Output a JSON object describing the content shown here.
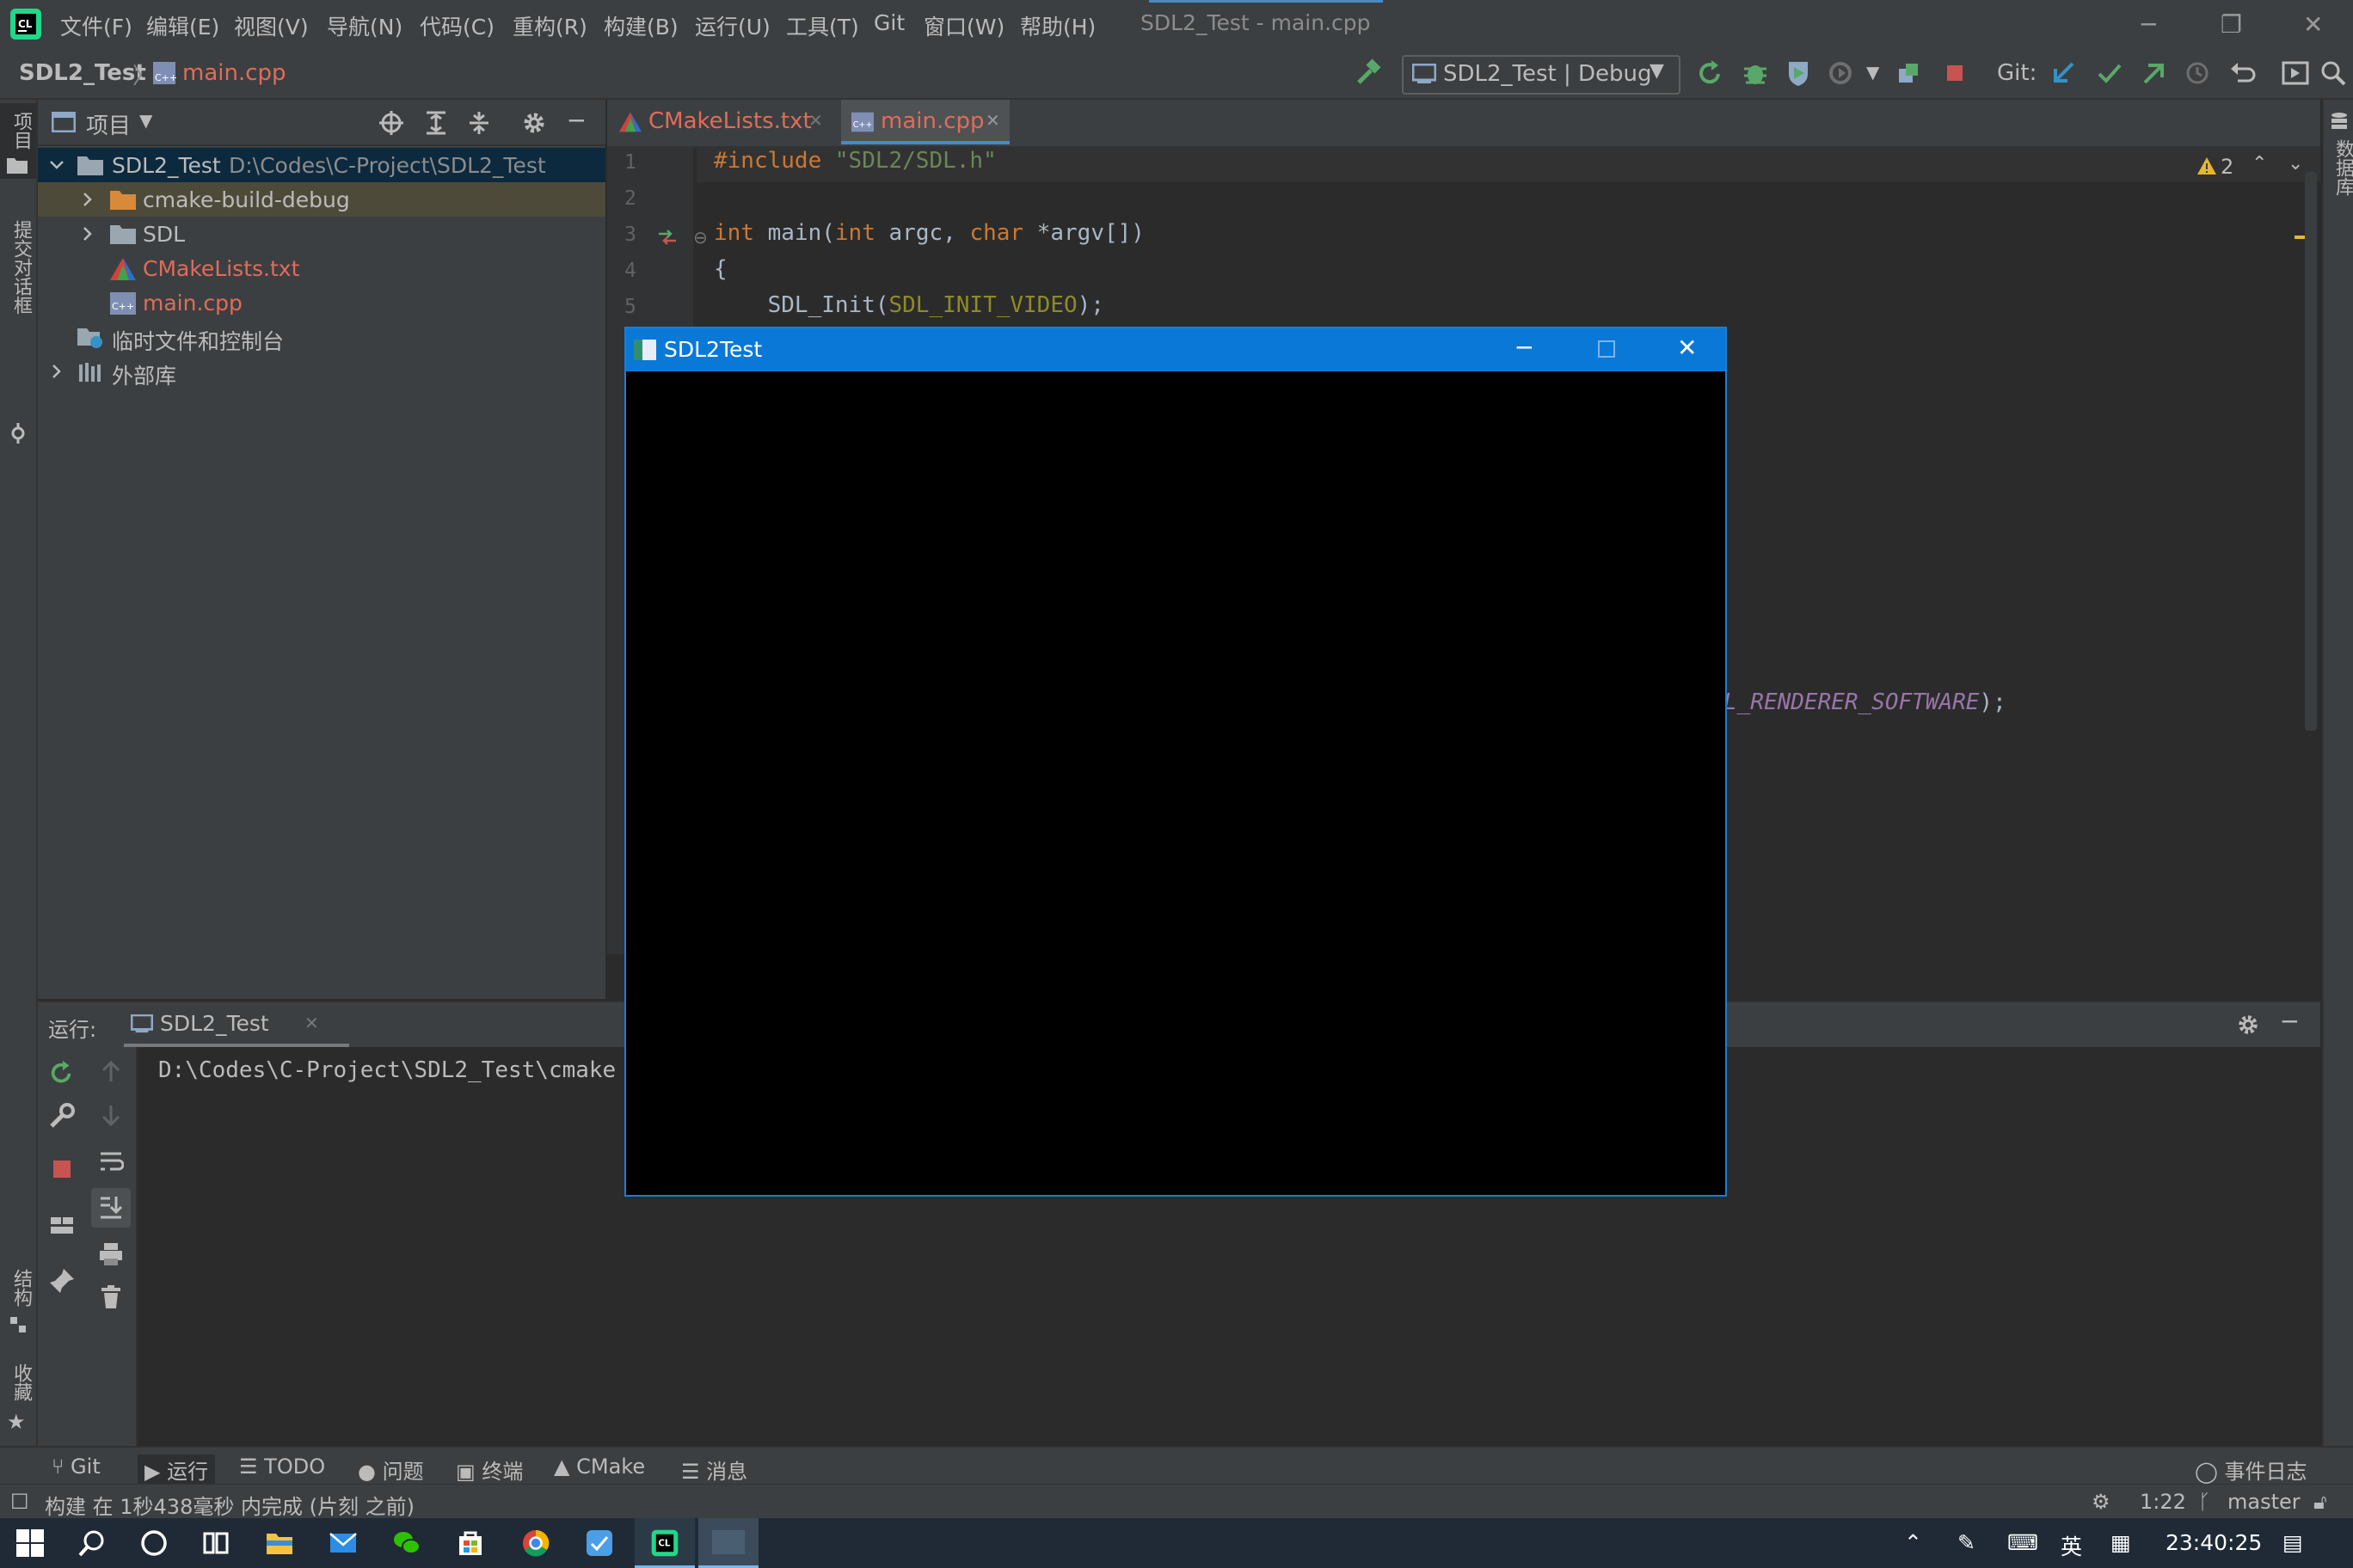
{
  "titlebar": {
    "menus": [
      "文件(F)",
      "编辑(E)",
      "视图(V)",
      "导航(N)",
      "代码(C)",
      "重构(R)",
      "构建(B)",
      "运行(U)",
      "工具(T)",
      "Git",
      "窗口(W)",
      "帮助(H)"
    ],
    "window_title": "SDL2_Test - main.cpp"
  },
  "navbar": {
    "project": "SDL2_Test",
    "file": "main.cpp",
    "run_config": "SDL2_Test | Debug",
    "git_label": "Git:"
  },
  "left_strip": {
    "project_label": "项目",
    "commit_label": "提交对话框",
    "structure_label": "结构",
    "favorites_label": "收藏"
  },
  "right_strip": {
    "database_label": "数据库"
  },
  "project_panel": {
    "title": "项目",
    "tree": {
      "root_name": "SDL2_Test",
      "root_path": "D:\\Codes\\C-Project\\SDL2_Test",
      "cmake_build": "cmake-build-debug",
      "sdl": "SDL",
      "cmakelists": "CMakeLists.txt",
      "main_cpp": "main.cpp",
      "scratches": "临时文件和控制台",
      "external": "外部库"
    }
  },
  "editor": {
    "tabs": [
      "CMakeLists.txt",
      "main.cpp"
    ],
    "warnings_count": "2",
    "line_numbers": [
      "1",
      "2",
      "3",
      "4",
      "5"
    ],
    "code": {
      "l1_kw": "#include",
      "l1_str": "\"SDL2/SDL.h\"",
      "l3_kw1": "int",
      "l3_mid1": " main(",
      "l3_kw2": "int",
      "l3_mid2": " argc, ",
      "l3_kw3": "char",
      "l3_mid3": " *argv[])",
      "l4": "{",
      "l5_pre": "    SDL_Init(",
      "l5_mac": "SDL_INIT_VIDEO",
      "l5_post": ");",
      "partial_prm": "L_RENDERER_SOFTWARE",
      "partial_post": ");"
    }
  },
  "run_panel": {
    "label": "运行:",
    "tab": "SDL2_Test",
    "console_line": "D:\\Codes\\C-Project\\SDL2_Test\\cmake"
  },
  "bottom_tools": {
    "git": "Git",
    "run": "运行",
    "todo": "TODO",
    "problems": "问题",
    "terminal": "终端",
    "cmake": "CMake",
    "messages": "消息",
    "event_log": "事件日志"
  },
  "status": {
    "message": "构建 在 1秒438毫秒 内完成 (片刻 之前)",
    "position": "1:22",
    "branch": "master"
  },
  "sdl_window": {
    "title": "SDL2Test"
  },
  "taskbar": {
    "ime_lang": "英",
    "clock": "23:40:25"
  },
  "colors": {
    "accent": "#0a78d7",
    "selection": "#0d293e",
    "keyword": "#cc7832",
    "string": "#6a8759",
    "red_file": "#e06c5a"
  }
}
